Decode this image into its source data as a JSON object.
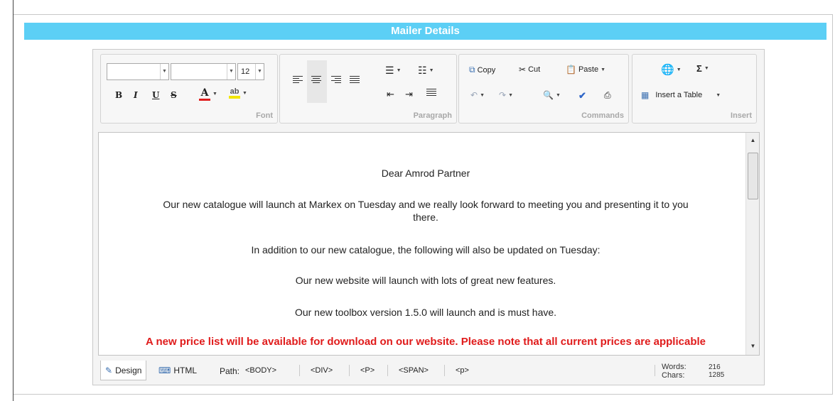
{
  "header": {
    "title": "Mailer Details"
  },
  "ribbon": {
    "font": {
      "label": "Font",
      "size_value": "12",
      "bold": "B",
      "italic": "I",
      "underline": "U",
      "strike": "S",
      "font_color_glyph": "A",
      "highlight_glyph": "ab"
    },
    "paragraph": {
      "label": "Paragraph"
    },
    "commands": {
      "label": "Commands",
      "copy": "Copy",
      "cut": "Cut",
      "paste": "Paste"
    },
    "insert": {
      "label": "Insert",
      "insert_table": "Insert a Table",
      "sigma": "Σ"
    }
  },
  "document": {
    "lines": [
      "Dear Amrod Partner",
      "Our new catalogue will launch at Markex on Tuesday and we really look forward to meeting you and presenting it to you",
      "there.",
      "In addition to our new catalogue, the following will also be updated on Tuesday:",
      "Our new website will launch with lots of great new features.",
      "Our new toolbox version 1.5.0 will launch and is must have.",
      "A new price list will be available for download on our website. Please note that all current prices are applicable"
    ]
  },
  "footer": {
    "design_tab": "Design",
    "html_tab": "HTML",
    "path_label": "Path:",
    "path": [
      "<BODY>",
      "<DIV>",
      "<P>",
      "<SPAN>",
      "<p>"
    ],
    "words_label": "Words:",
    "words": "216",
    "chars_label": "Chars:",
    "chars": "1285"
  },
  "colors": {
    "header": "#5ccff5",
    "warning_text": "#e01b1b"
  }
}
